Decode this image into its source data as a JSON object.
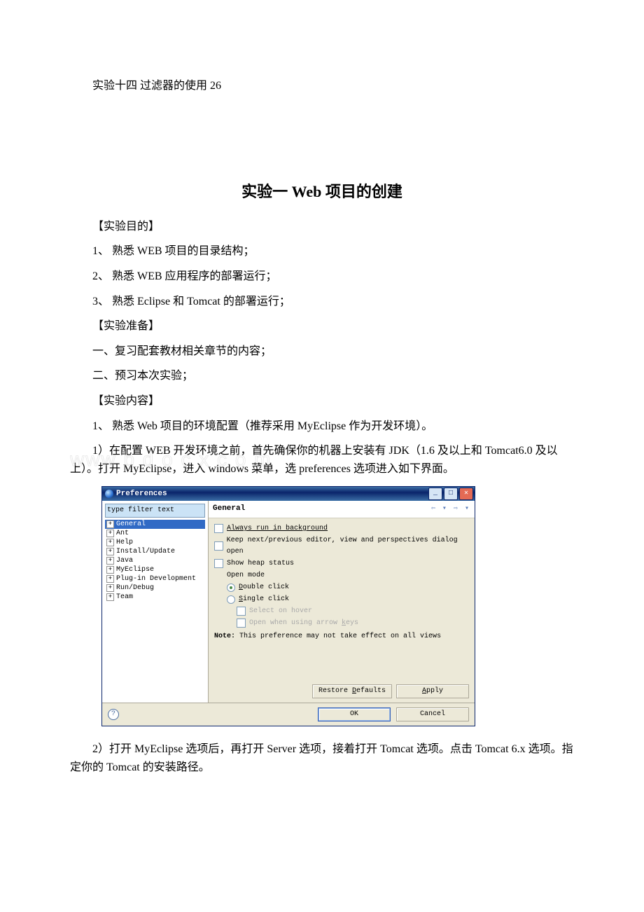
{
  "doc": {
    "toc_line": "实验十四 过滤器的使用 26",
    "heading": "实验一 Web 项目的创建",
    "p_objective_label": "【实验目的】",
    "p_obj_1": "1、 熟悉 WEB 项目的目录结构；",
    "p_obj_2": "2、 熟悉 WEB 应用程序的部署运行；",
    "p_obj_3": "3、 熟悉 Eclipse 和 Tomcat 的部署运行；",
    "p_prepare_label": "【实验准备】",
    "p_prep_1": "一、复习配套教材相关章节的内容；",
    "p_prep_2": "二、预习本次实验；",
    "p_content_label": "【实验内容】",
    "p_cont_1": "1、 熟悉 Web 项目的环境配置（推荐采用 MyEclipse 作为开发环境）。",
    "p_cont_1_1": "1）在配置 WEB 开发环境之前，首先确保你的机器上安装有 JDK（1.6 及以上和 Tomcat6.0 及以上）。打开 MyEclipse，进入 windows 菜单，选 preferences 选项进入如下界面。",
    "p_cont_2": "2）打开 MyEclipse 选项后，再打开 Server 选项，接着打开 Tomcat 选项。点击 Tomcat 6.x 选项。指定你的 Tomcat 的安装路径。"
  },
  "prefs": {
    "window_title": "Preferences",
    "filter_text": "type filter text",
    "tree": [
      "General",
      "Ant",
      "Help",
      "Install/Update",
      "Java",
      "MyEclipse",
      "Plug-in Development",
      "Run/Debug",
      "Team"
    ],
    "section_title": "General",
    "chk_bg": "Always run in background",
    "chk_keep": "Keep next/previous editor, view and perspectives dialog open",
    "chk_heap": "Show heap status",
    "open_mode_label": "Open mode",
    "rad_double_pre": "D",
    "rad_double_rest": "ouble click",
    "rad_single_pre": "S",
    "rad_single_rest": "ingle click",
    "chk_hover": "Select on hover",
    "chk_arrow_pre": "Open when using arrow ",
    "chk_arrow_u": "k",
    "chk_arrow_post": "eys",
    "note_bold": "Note:",
    "note_rest": " This preference may not take effect on all views",
    "btn_restore_pre": "Restore ",
    "btn_restore_u": "D",
    "btn_restore_post": "efaults",
    "btn_apply_u": "A",
    "btn_apply_post": "pply",
    "btn_ok": "OK",
    "btn_cancel": "Cancel"
  }
}
